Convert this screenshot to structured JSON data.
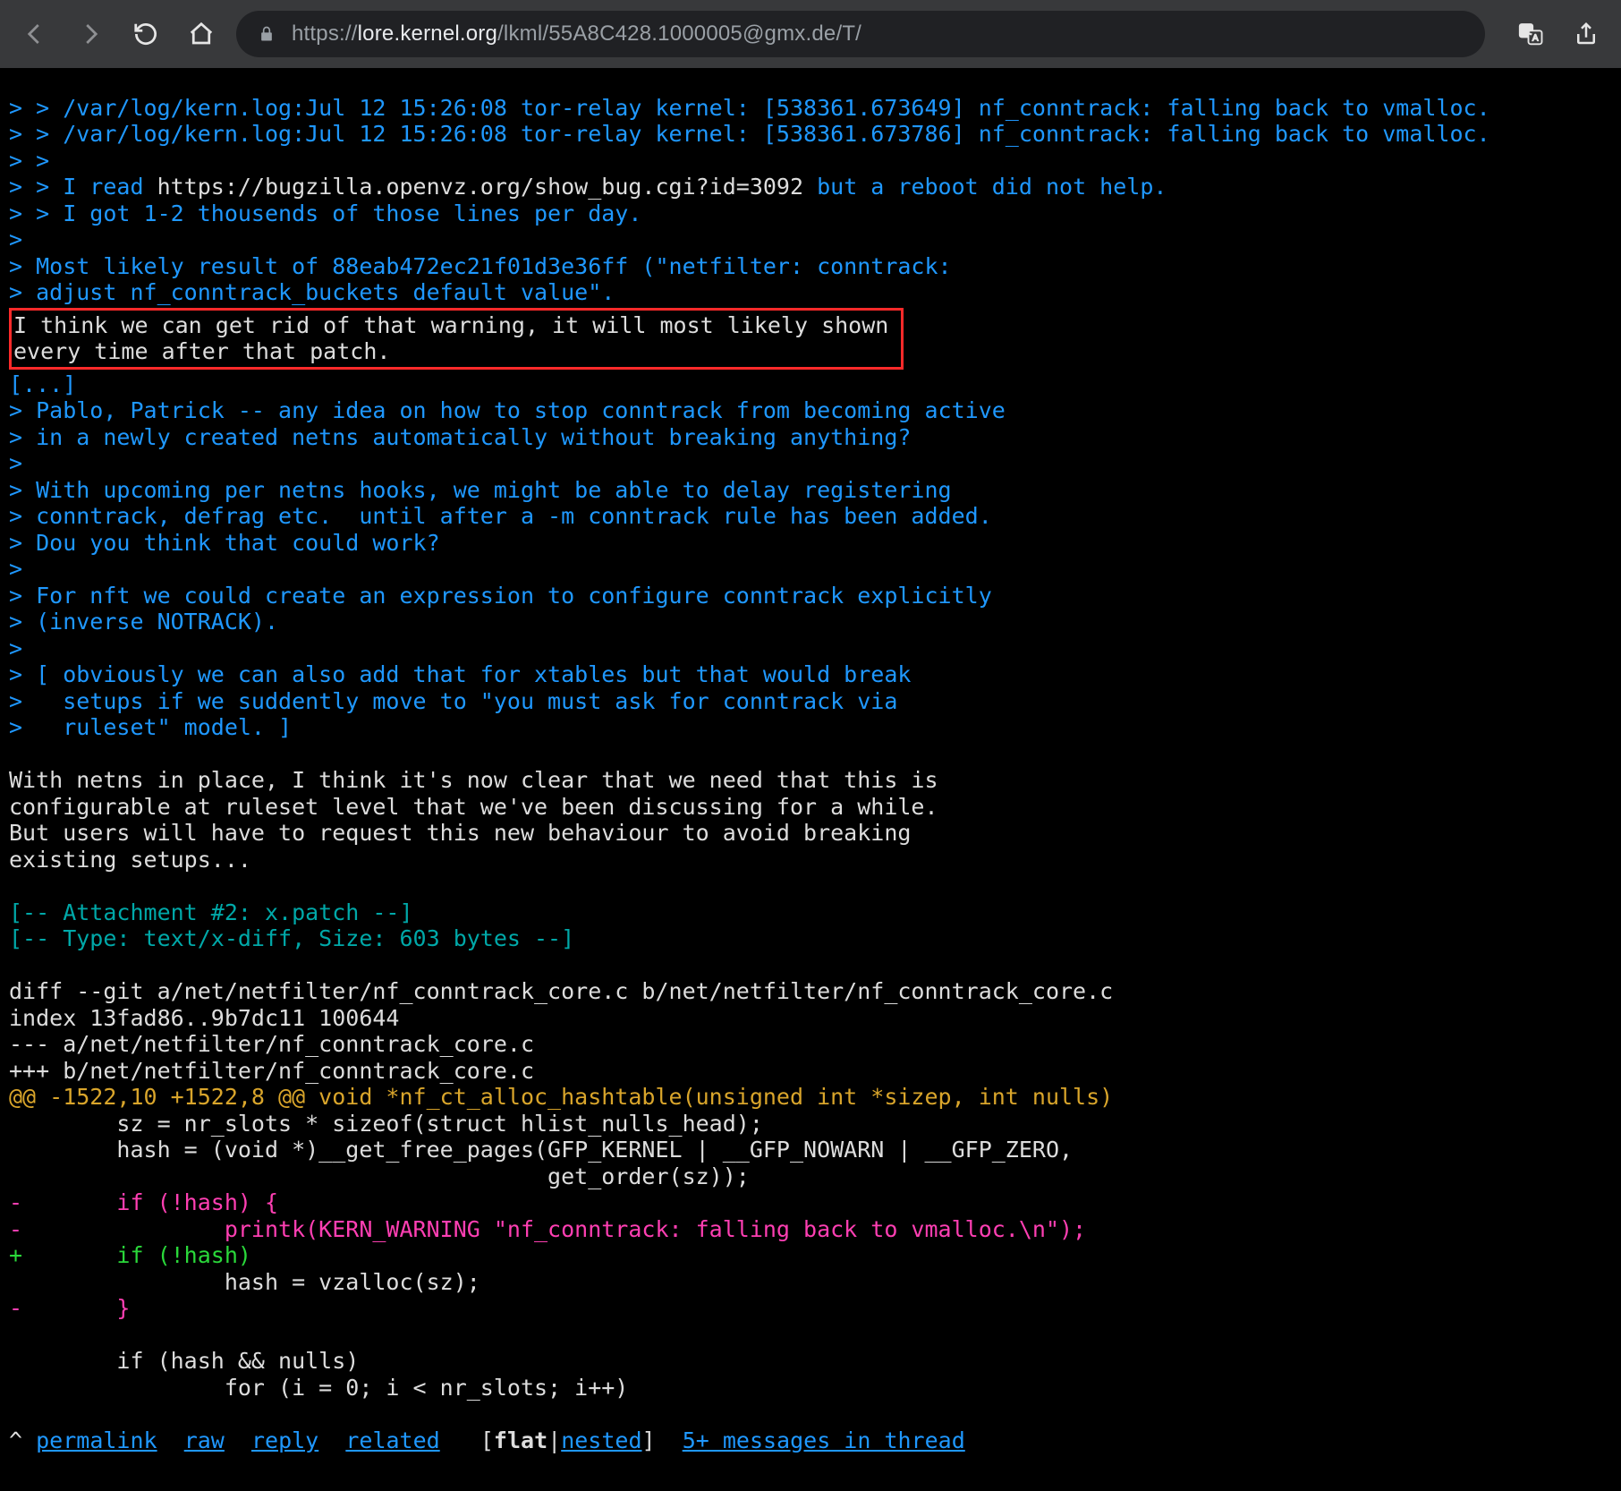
{
  "browser": {
    "url_prefix": "https://",
    "url_domain": "lore.kernel.org",
    "url_path": "/lkml/55A8C428.1000005@gmx.de/T/"
  },
  "email": {
    "q1_lines": [
      "> > /var/log/kern.log:Jul 12 15:26:08 tor-relay kernel: [538361.673649] nf_conntrack: falling back to vmalloc.",
      "> > /var/log/kern.log:Jul 12 15:26:08 tor-relay kernel: [538361.673786] nf_conntrack: falling back to vmalloc."
    ],
    "q1_blank": "> >",
    "q1_readline_pre": "> > I read ",
    "q1_url": "https://bugzilla.openvz.org/show_bug.cgi?id=3092",
    "q1_readline_post": " but a reboot did not help.",
    "q1_got": "> > I got 1-2 thousends of those lines per day.",
    "q1_gt": ">",
    "q1_most": "> Most likely result of 88eab472ec21f01d3e36ff (\"netfilter: conntrack:",
    "q1_adjust": "> adjust nf_conntrack_buckets default value\".",
    "hl_l1": "I think we can get rid of that warning, it will most likely shown",
    "hl_l2": "every time after that patch.",
    "ellipsis": "[...]",
    "q2_lines": [
      "> Pablo, Patrick -- any idea on how to stop conntrack from becoming active",
      "> in a newly created netns automatically without breaking anything?",
      ">",
      "> With upcoming per netns hooks, we might be able to delay registering",
      "> conntrack, defrag etc.  until after a -m conntrack rule has been added.",
      "> Dou you think that could work?",
      ">",
      "> For nft we could create an expression to configure conntrack explicitly",
      "> (inverse NOTRACK).",
      ">",
      "> [ obviously we can also add that for xtables but that would break",
      ">   setups if we suddently move to \"you must ask for conntrack via",
      ">   ruleset\" model. ]"
    ],
    "body_lines": [
      "With netns in place, I think it's now clear that we need that this is",
      "configurable at ruleset level that we've been discussing for a while.",
      "But users will have to request this new behaviour to avoid breaking",
      "existing setups..."
    ],
    "attach_l1": "[-- Attachment #2: x.patch --]",
    "attach_l2": "[-- Type: text/x-diff, Size: 603 bytes --]",
    "diff_head": [
      "diff --git a/net/netfilter/nf_conntrack_core.c b/net/netfilter/nf_conntrack_core.c",
      "index 13fad86..9b7dc11 100644",
      "--- a/net/netfilter/nf_conntrack_core.c",
      "+++ b/net/netfilter/nf_conntrack_core.c"
    ],
    "hunk": "@@ -1522,10 +1522,8 @@ void *nf_ct_alloc_hashtable(unsigned int *sizep, int nulls)",
    "ctx1": "        sz = nr_slots * sizeof(struct hlist_nulls_head);",
    "ctx2": "        hash = (void *)__get_free_pages(GFP_KERNEL | __GFP_NOWARN | __GFP_ZERO,",
    "ctx3": "                                        get_order(sz));",
    "del1": "-       if (!hash) {",
    "del2": "-               printk(KERN_WARNING \"nf_conntrack: falling back to vmalloc.\\n\");",
    "add1": "+       if (!hash)",
    "ctx4": "                hash = vzalloc(sz);",
    "del3": "-       }",
    "ctx5a": " ",
    "ctx5": "        if (hash && nulls)",
    "ctx6": "                for (i = 0; i < nr_slots; i++)"
  },
  "footer": {
    "caret": "^",
    "permalink": "permalink",
    "raw": "raw",
    "reply": "reply",
    "related": "related",
    "flat": "flat",
    "nested": "nested",
    "tail": "5+ messages in thread"
  }
}
